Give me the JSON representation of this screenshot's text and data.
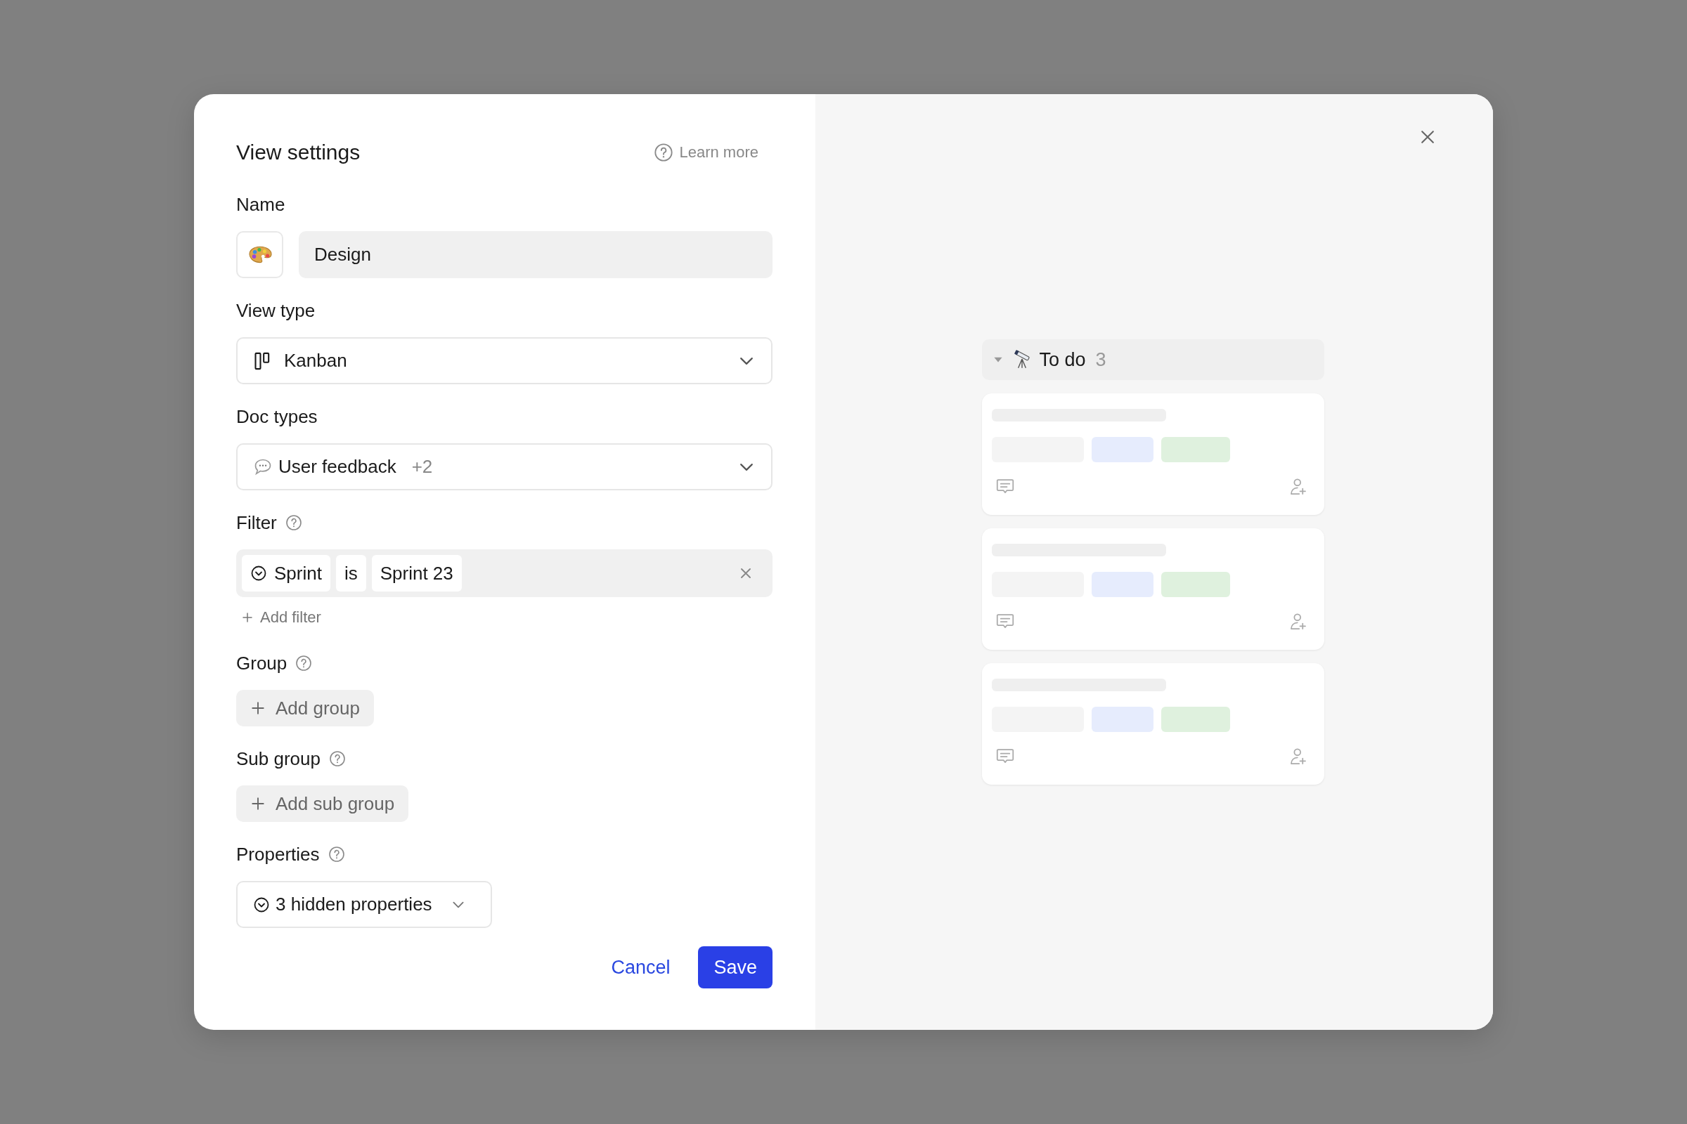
{
  "dialog": {
    "title": "View settings",
    "learn_more": "Learn more"
  },
  "name": {
    "label": "Name",
    "value": "Design"
  },
  "view_type": {
    "label": "View type",
    "value": "Kanban"
  },
  "doc_types": {
    "label": "Doc types",
    "value": "User feedback",
    "extra": "+2"
  },
  "filter": {
    "label": "Filter",
    "chips": [
      {
        "kind": "property",
        "text": "Sprint"
      },
      {
        "kind": "operator",
        "text": "is"
      },
      {
        "kind": "value",
        "text": "Sprint 23"
      }
    ],
    "add": "Add filter"
  },
  "group": {
    "label": "Group",
    "button": "Add group"
  },
  "sub_group": {
    "label": "Sub group",
    "button": "Add sub group"
  },
  "properties": {
    "label": "Properties",
    "value": "3 hidden properties"
  },
  "actions": [
    {
      "kind": "link",
      "label": "Cancel"
    },
    {
      "kind": "primary",
      "label": "Save"
    }
  ],
  "preview": {
    "column": {
      "title": "To do",
      "count": "3",
      "expanded": true
    },
    "cards": [
      {
        "kind": "skeleton"
      },
      {
        "kind": "skeleton"
      },
      {
        "kind": "skeleton"
      }
    ]
  }
}
